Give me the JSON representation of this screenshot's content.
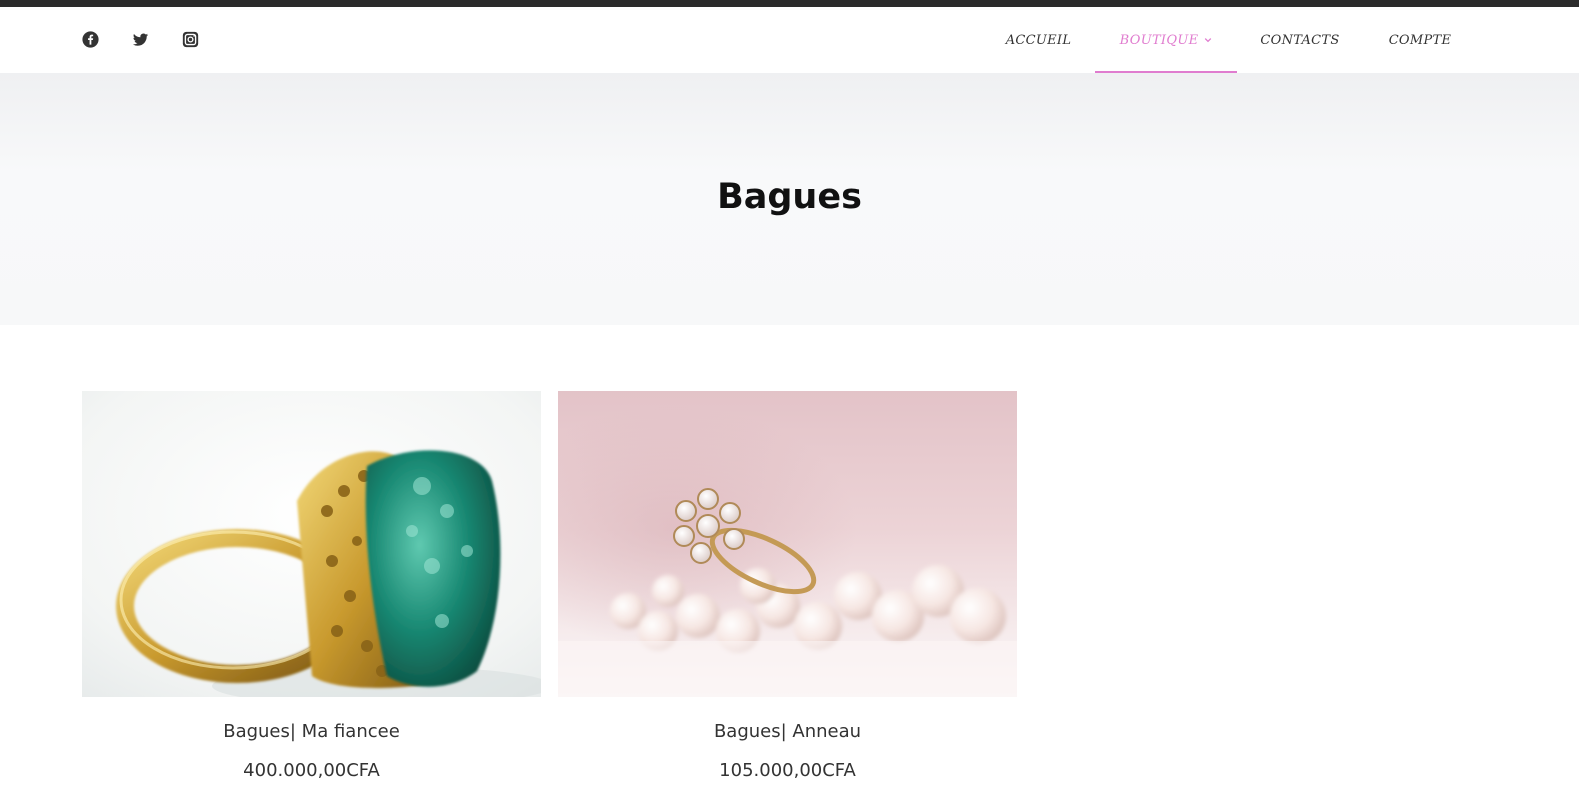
{
  "header": {
    "social": [
      {
        "name": "facebook-icon"
      },
      {
        "name": "twitter-icon"
      },
      {
        "name": "instagram-icon"
      }
    ],
    "nav": {
      "accueil": "ACCUEIL",
      "boutique": "BOUTIQUE",
      "contacts": "CONTACTS",
      "compte": "COMPTE"
    },
    "accent_color": "#e07ccf"
  },
  "page": {
    "title": "Bagues"
  },
  "products": [
    {
      "title": "Bagues| Ma fiancee",
      "price": "400.000,00CFA",
      "image": "emerald-gold-ring-photo"
    },
    {
      "title": "Bagues| Anneau",
      "price": "105.000,00CFA",
      "image": "diamond-ring-pearls-photo"
    }
  ]
}
